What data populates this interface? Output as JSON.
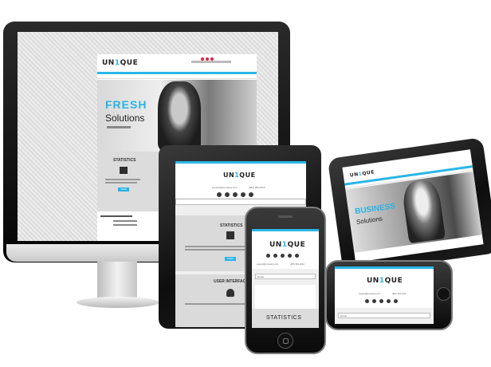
{
  "brand": {
    "logo_pre": "UN",
    "logo_one": "1",
    "logo_post": "QUE",
    "accent": "#2ab6e6"
  },
  "desktop": {
    "hero_title": "FRESH",
    "hero_subtitle": "Solutions",
    "stats_title": "STATISTICS",
    "button_label": "VIEW"
  },
  "tablet_portrait": {
    "email": "support@company.com",
    "phone": "(987) 654-3210",
    "stats_title": "STATISTICS",
    "ui_title": "USER INTERFACE",
    "button_label": "VIEW"
  },
  "tablet_landscape": {
    "hero_title": "BUSINESS",
    "hero_subtitle": "Solutions"
  },
  "phone_portrait": {
    "email": "support@company.com",
    "phone": "(987) 654-3210",
    "select_value": "Home",
    "stats_title": "STATISTICS"
  },
  "phone_landscape": {
    "email": "support@company.com",
    "phone": "(987) 654-3210",
    "select_value": "Home"
  }
}
